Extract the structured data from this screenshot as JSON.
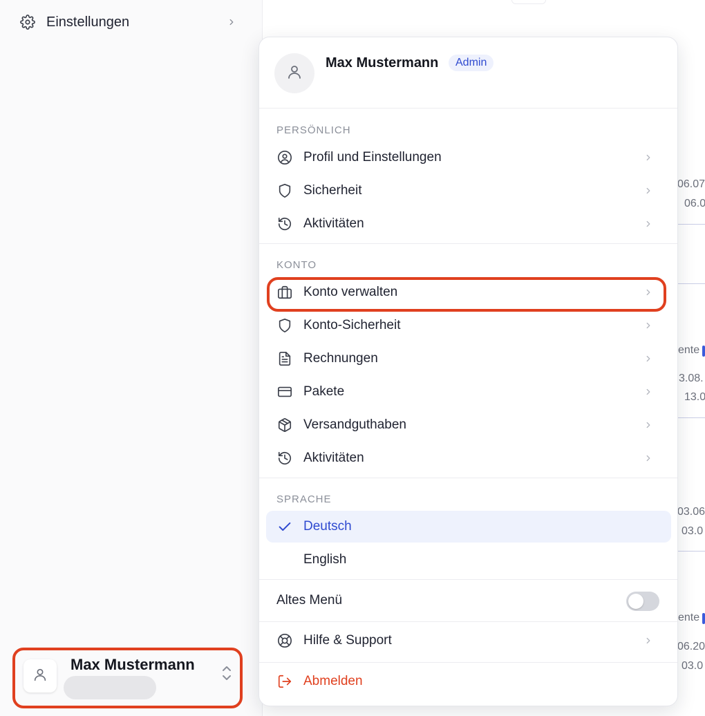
{
  "sidebar": {
    "settings_label": "Einstellungen",
    "user_name": "Max Mustermann"
  },
  "background": {
    "frag1": "06.07",
    "frag2": "06.0",
    "frag3": "ente",
    "frag4": "3.08.",
    "frag5": "13.0",
    "frag6": "03.06",
    "frag7": "03.0",
    "frag8": "ente",
    "frag9": "06.20",
    "frag10": "03.0"
  },
  "menu": {
    "user_name": "Max Mustermann",
    "role_badge": "Admin",
    "sections": {
      "personal": "PERSÖNLICH",
      "account": "KONTO",
      "language": "SPRACHE"
    },
    "personal_items": [
      {
        "label": "Profil und Einstellungen",
        "icon": "user-circle-icon"
      },
      {
        "label": "Sicherheit",
        "icon": "shield-icon"
      },
      {
        "label": "Aktivitäten",
        "icon": "history-icon"
      }
    ],
    "account_items": [
      {
        "label": "Konto verwalten",
        "icon": "briefcase-icon"
      },
      {
        "label": "Konto-Sicherheit",
        "icon": "shield-icon"
      },
      {
        "label": "Rechnungen",
        "icon": "document-icon"
      },
      {
        "label": "Pakete",
        "icon": "credit-card-icon"
      },
      {
        "label": "Versandguthaben",
        "icon": "package-icon"
      },
      {
        "label": "Aktivitäten",
        "icon": "history-icon"
      }
    ],
    "languages": [
      {
        "label": "Deutsch",
        "selected": true
      },
      {
        "label": "English",
        "selected": false
      }
    ],
    "old_menu_label": "Altes Menü",
    "old_menu_enabled": false,
    "help_label": "Hilfe & Support",
    "logout_label": "Abmelden"
  },
  "colors": {
    "accent": "#2f4ad0",
    "danger": "#e0401f",
    "highlight_outline": "#e0401f"
  }
}
